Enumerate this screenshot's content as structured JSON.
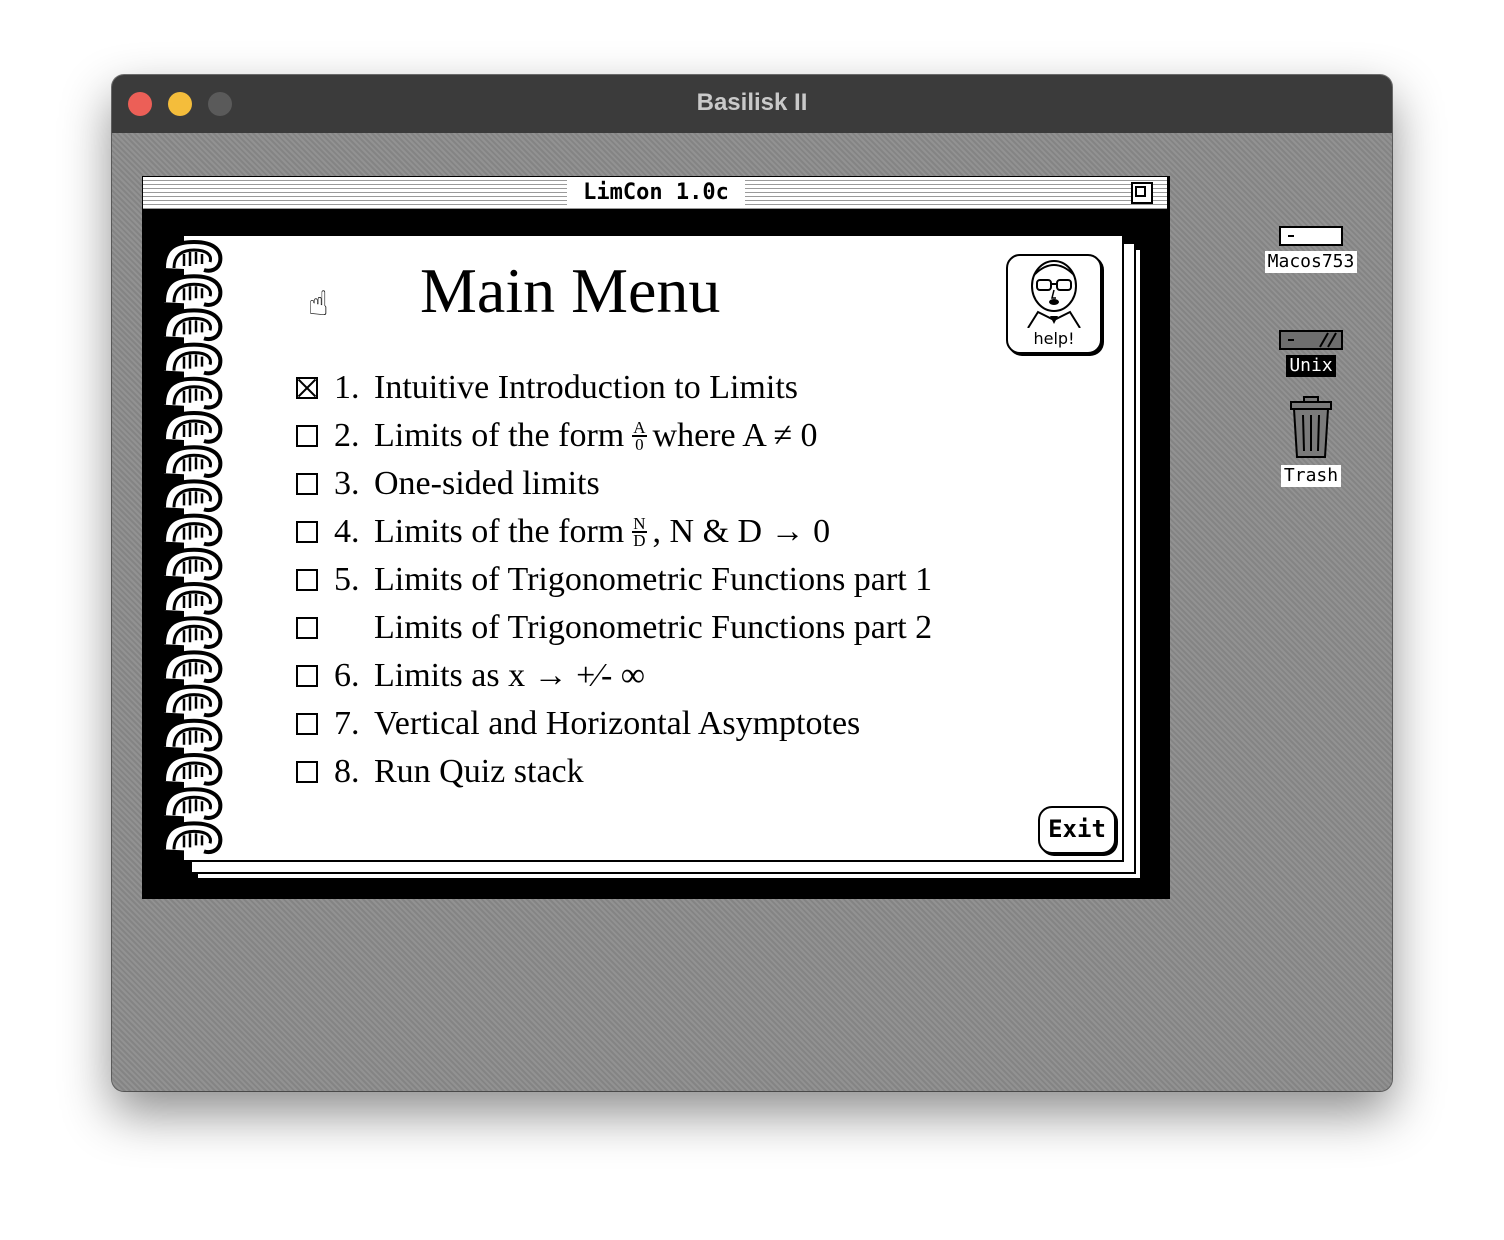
{
  "host": {
    "title": "Basilisk II"
  },
  "app": {
    "window_title": "LimCon 1.0c",
    "menu_title": "Main Menu",
    "help_label": "help!",
    "exit_label": "Exit",
    "items": [
      {
        "checked": true,
        "num": "1.",
        "text": "Intuitive Introduction to Limits"
      },
      {
        "checked": false,
        "num": "2.",
        "text_before": "Limits of the form",
        "frac_num": "A",
        "frac_den": "0",
        "text_after": "where A ≠ 0"
      },
      {
        "checked": false,
        "num": "3.",
        "text": "One-sided limits"
      },
      {
        "checked": false,
        "num": "4.",
        "text_before": "Limits of the form",
        "frac_num": "N",
        "frac_den": "D",
        "text_after": ", N & D → 0"
      },
      {
        "checked": false,
        "num": "5.",
        "text": "Limits of Trigonometric Functions part 1"
      },
      {
        "checked": false,
        "num": "",
        "text": "Limits of Trigonometric Functions part 2"
      },
      {
        "checked": false,
        "num": "6.",
        "text": "Limits as x → +⁄- ∞"
      },
      {
        "checked": false,
        "num": "7.",
        "text": "Vertical and Horizontal Asymptotes"
      },
      {
        "checked": false,
        "num": "8.",
        "text": "Run Quiz stack"
      }
    ]
  },
  "desktop": {
    "icons": [
      {
        "label": "Macos753",
        "icon": "disk-icon",
        "selected": false
      },
      {
        "label": "Unix",
        "icon": "unix-volume-icon",
        "selected": true
      },
      {
        "label": "Trash",
        "icon": "trash-icon",
        "selected": false
      }
    ]
  }
}
